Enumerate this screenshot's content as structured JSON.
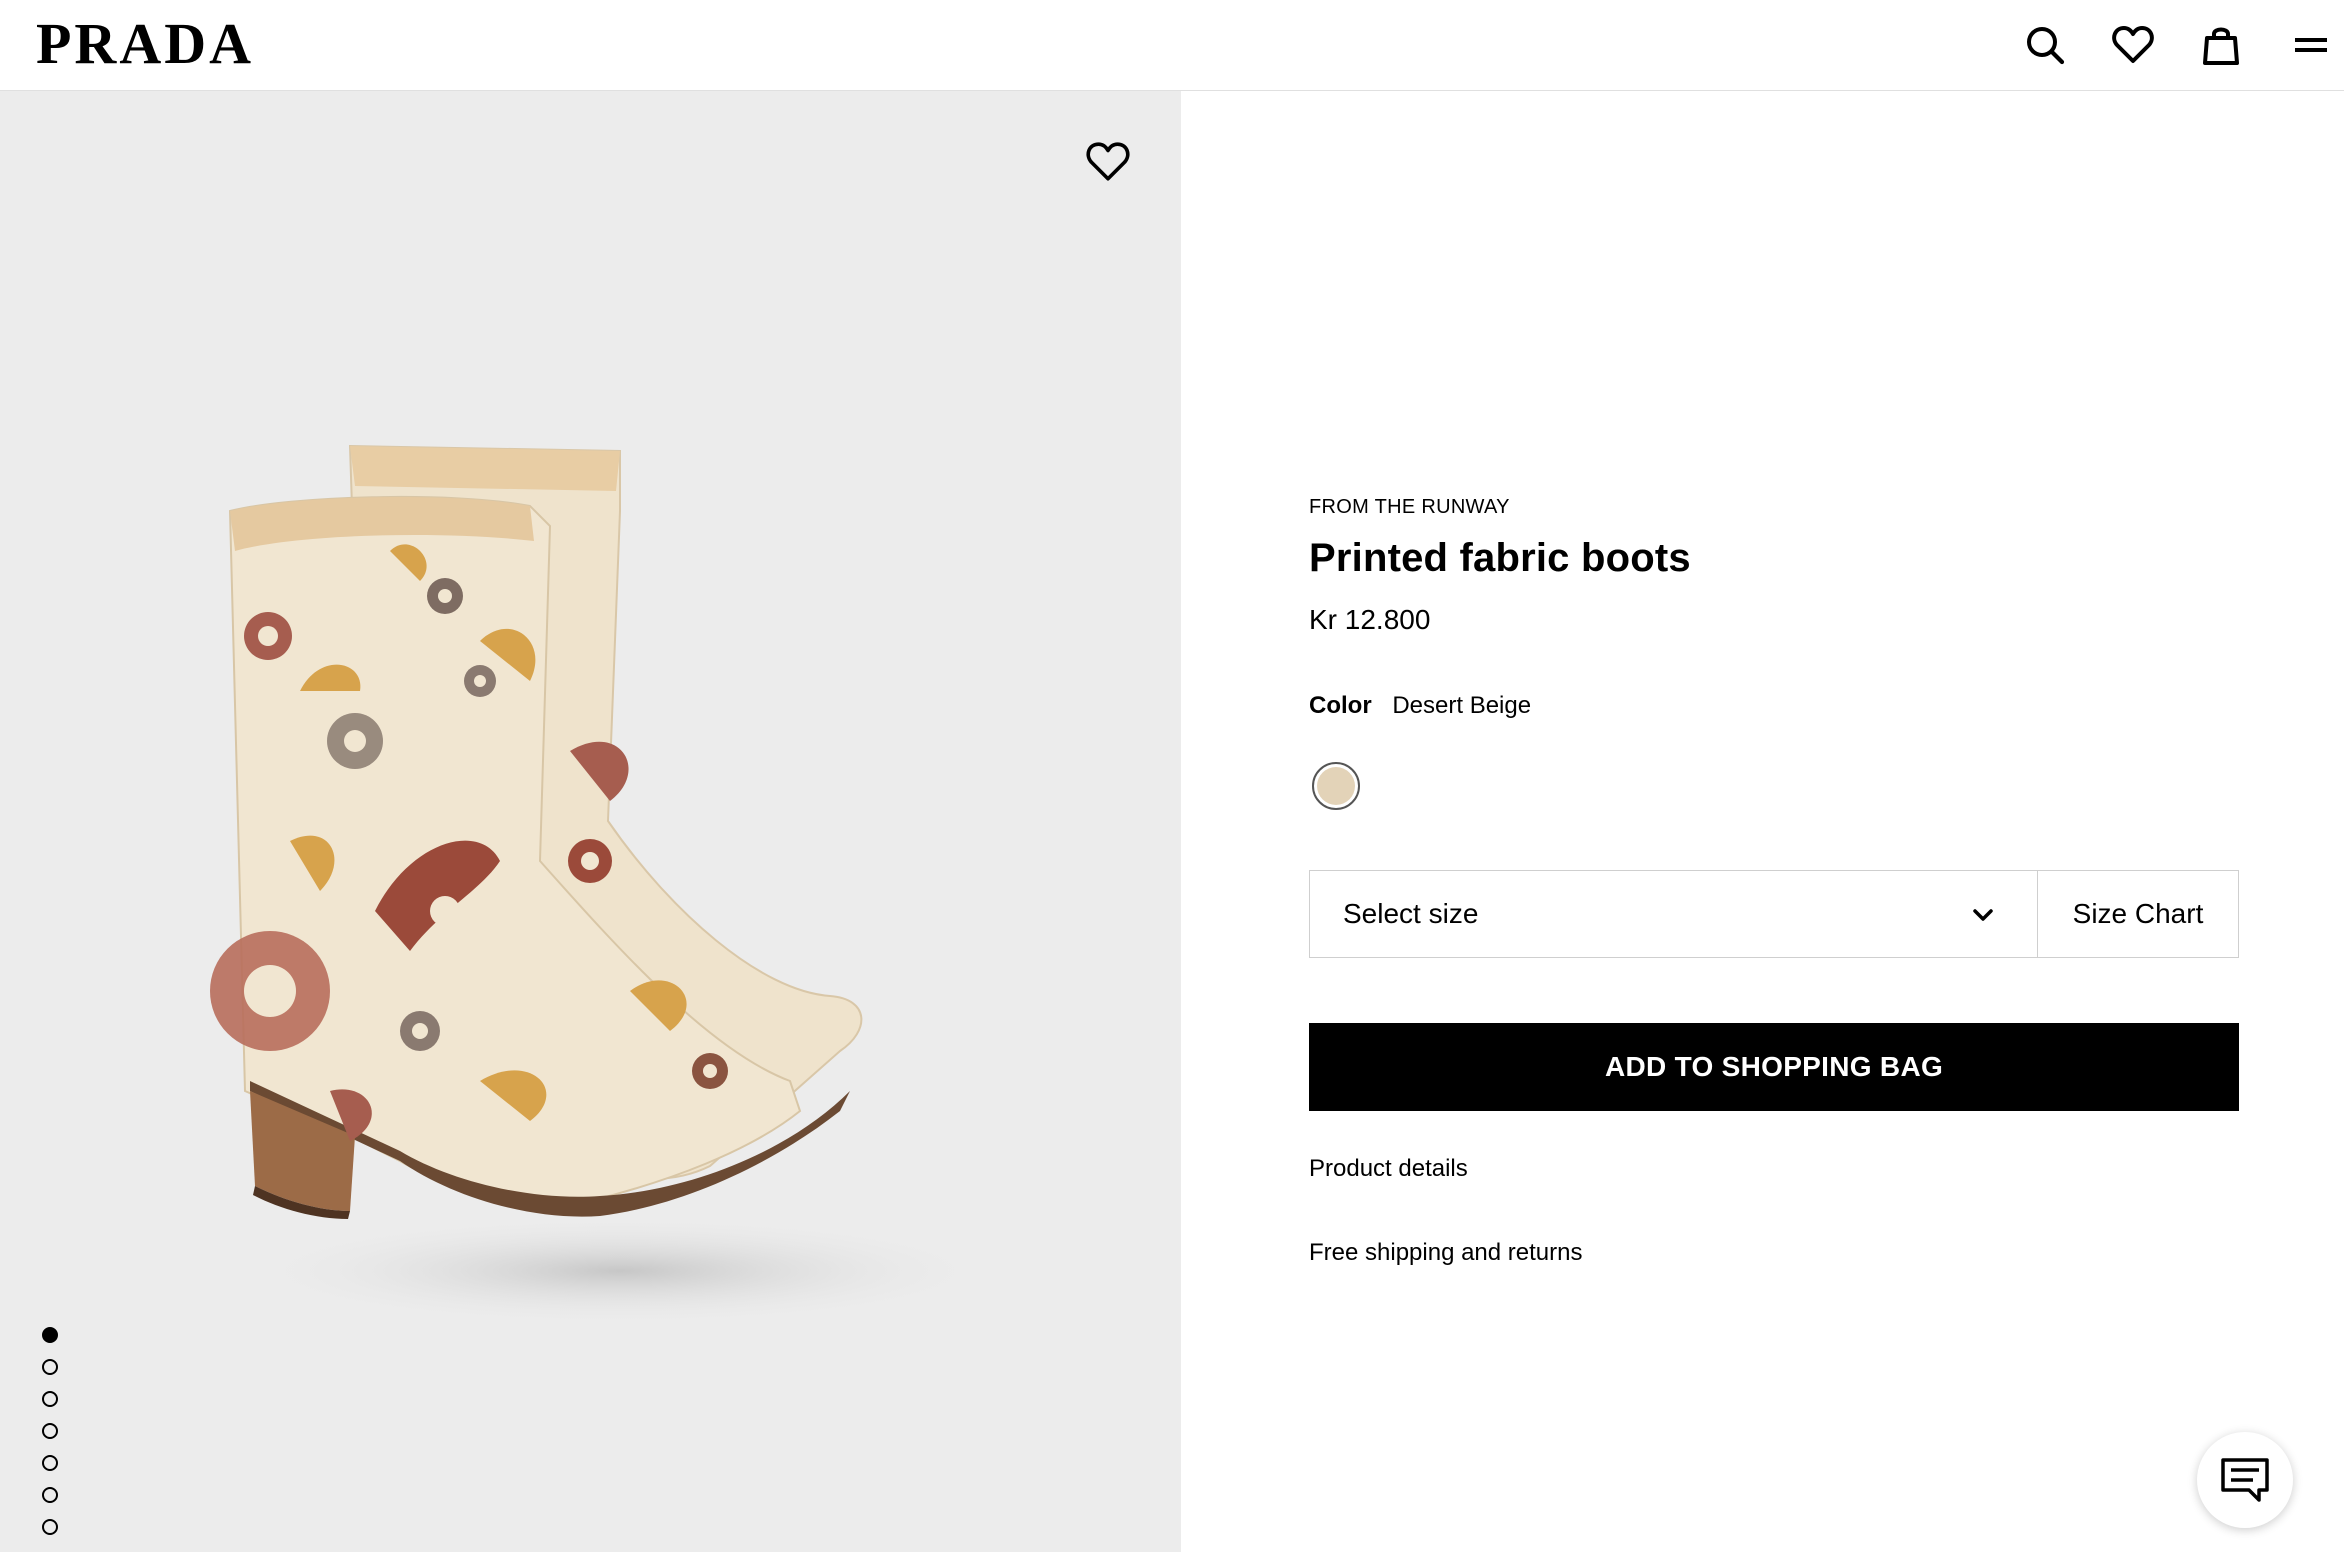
{
  "header": {
    "logo": "PRADA",
    "icons": [
      "search-icon",
      "heart-icon",
      "shopping-bag-icon",
      "menu-icon"
    ]
  },
  "gallery": {
    "image_alt": "Printed fabric boots",
    "dot_count": 7,
    "active_index": 0
  },
  "product": {
    "eyebrow": "FROM THE RUNWAY",
    "name": "Printed fabric boots",
    "price": "Kr 12.800",
    "color_label": "Color",
    "color_value": "Desert Beige",
    "swatch_color": "#e3d3b8"
  },
  "size": {
    "placeholder": "Select size",
    "chart_label": "Size Chart"
  },
  "actions": {
    "add_to_bag": "ADD TO SHOPPING BAG"
  },
  "links": {
    "details": "Product details",
    "shipping": "Free shipping and returns"
  },
  "colors": {
    "gallery_bg": "#ececec",
    "primary": "#000000"
  }
}
